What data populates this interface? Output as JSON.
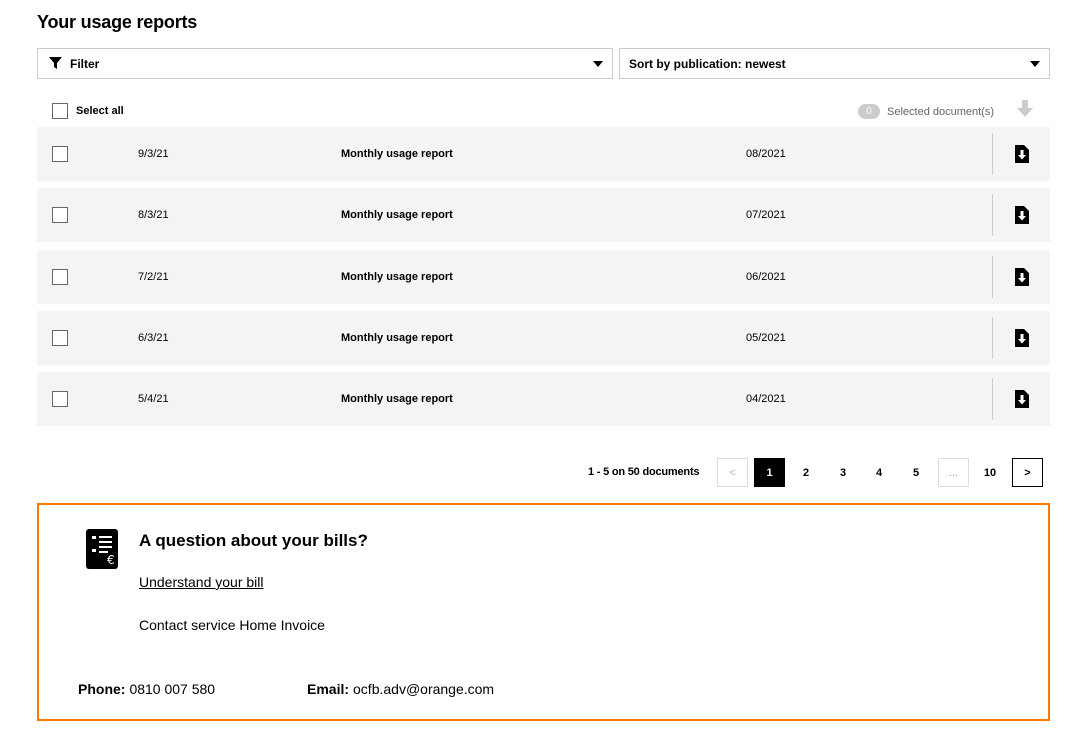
{
  "page": {
    "title": "Your usage reports"
  },
  "filter": {
    "label": "Filter"
  },
  "sort": {
    "label": "Sort by publication: newest"
  },
  "list_header": {
    "select_all_label": "Select all",
    "selected_count": "0",
    "selected_label": "Selected document(s)"
  },
  "reports": [
    {
      "date": "9/3/21",
      "document": "Monthly usage report",
      "period": "08/2021"
    },
    {
      "date": "8/3/21",
      "document": "Monthly usage report",
      "period": "07/2021"
    },
    {
      "date": "7/2/21",
      "document": "Monthly usage report",
      "period": "06/2021"
    },
    {
      "date": "6/3/21",
      "document": "Monthly usage report",
      "period": "05/2021"
    },
    {
      "date": "5/4/21",
      "document": "Monthly usage report",
      "period": "04/2021"
    }
  ],
  "pagination": {
    "summary": "1 - 5 on 50 documents",
    "prev": "<",
    "pages": [
      "1",
      "2",
      "3",
      "4",
      "5"
    ],
    "ellipsis": "...",
    "last": "10",
    "next": ">",
    "current": "1"
  },
  "help": {
    "title": "A question about your bills?",
    "link": "Understand your bill",
    "contact": "Contact service Home Invoice",
    "phone_label": "Phone:",
    "phone": "0810 007 580",
    "email_label": "Email:",
    "email": "ocfb.adv@orange.com"
  },
  "colors": {
    "accent": "#ff7900",
    "row_bg": "#f4f4f4",
    "border": "#cccccc"
  }
}
